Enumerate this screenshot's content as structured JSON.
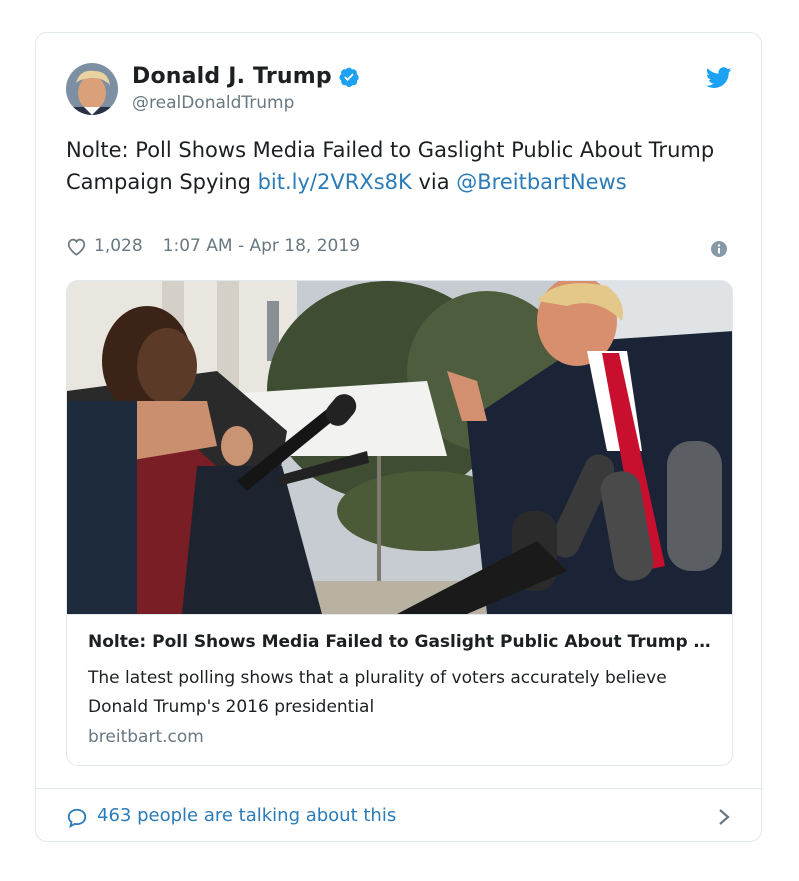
{
  "author": {
    "name": "Donald J. Trump",
    "handle": "@realDonaldTrump",
    "verified_icon": "verified-badge-icon",
    "avatar": "profile-photo"
  },
  "tweet": {
    "text_part1": "Nolte: Poll Shows Media Failed to Gaslight Public About Trump Campaign Spying ",
    "link": "bit.ly/2VRXs8K",
    "text_part2": " via ",
    "mention": "@BreitbartNews",
    "likes": "1,028",
    "timestamp": "1:07 AM - Apr 18, 2019"
  },
  "card": {
    "title": "Nolte: Poll Shows Media Failed to Gaslight Public About Trump Campaign Spying",
    "description": "The latest polling shows that a plurality of voters accurately believe Donald Trump's 2016 presidential",
    "domain": "breitbart.com",
    "image": "press-gaggle-photo"
  },
  "footer": {
    "talking": "463 people are talking about this"
  },
  "colors": {
    "accent": "#2b7bb9",
    "twitter_blue": "#1da1f2",
    "muted": "#697882",
    "border": "#e1e8ed"
  }
}
